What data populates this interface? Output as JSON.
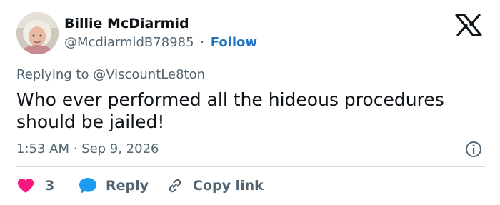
{
  "author": {
    "display_name": "Billie McDiarmid",
    "handle": "@McdiarmidB78985",
    "separator": "·",
    "follow_label": "Follow"
  },
  "logo": "x-logo-icon",
  "reply_context": "Replying to @ViscountLe8ton",
  "tweet": {
    "text": "Who ever performed all the hideous procedures should be jailed!",
    "timestamp": "1:53 AM · Sep 9, 2026"
  },
  "actions": {
    "like_count": "3",
    "reply_label": "Reply",
    "copy_label": "Copy link"
  },
  "colors": {
    "link": "#1d73c5",
    "muted": "#536471",
    "like": "#f91880",
    "reply_bubble": "#1d9bf0",
    "divider": "#cfd9de"
  }
}
